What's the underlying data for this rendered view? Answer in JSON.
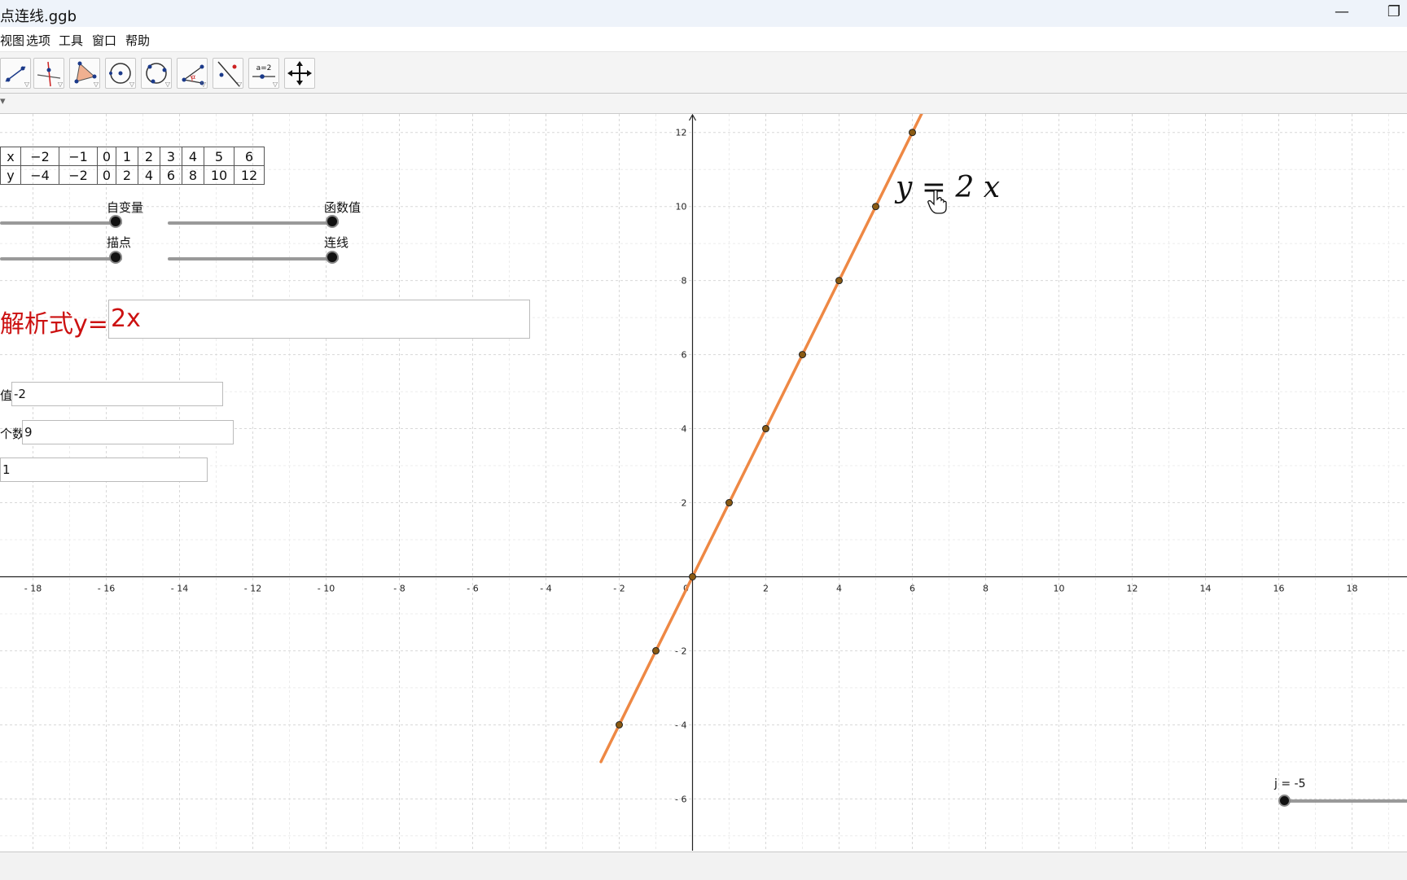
{
  "window": {
    "title": "点连线.ggb",
    "minimize_glyph": "—",
    "restore_glyph": "❐"
  },
  "menu": {
    "items": [
      "视图",
      "选项",
      "工具",
      "窗口",
      "帮助"
    ]
  },
  "toolbar": {
    "tools": [
      "segment-tool",
      "perpendicular-line-tool",
      "polygon-tool",
      "circle-center-point-tool",
      "circle-three-points-tool",
      "angle-tool",
      "reflect-tool",
      "slider-tool",
      "move-graphics-view-tool"
    ],
    "slider_tool_label": "a=2"
  },
  "stylebar": {
    "toggle": "▾"
  },
  "table": {
    "x_header": "x",
    "y_header": "y",
    "x_values": [
      "−2",
      "−1",
      "0",
      "1",
      "2",
      "3",
      "4",
      "5",
      "6"
    ],
    "y_values": [
      "−4",
      "−2",
      "0",
      "2",
      "4",
      "6",
      "8",
      "10",
      "12"
    ]
  },
  "sliders": {
    "independent_label": "自变量",
    "function_value_label": "函数值",
    "plot_points_label": "描点",
    "connect_label": "连线",
    "j_label": "j = -5",
    "independent_value": 1,
    "function_value_value": 1,
    "plot_points_value": 1,
    "connect_value": 1
  },
  "expression": {
    "label": "解析式y=",
    "value": "2x"
  },
  "fields": {
    "start_label": "值",
    "start_value": "-2",
    "count_label": "个数",
    "count_value": "9",
    "step_value": "1"
  },
  "equation_label": "y = 2 x",
  "chart_data": {
    "type": "line",
    "function": "y = 2x",
    "xlim": [
      -18.9,
      19.5
    ],
    "ylim": [
      -7.4,
      12.5
    ],
    "x_ticks": [
      -18,
      -16,
      -14,
      -12,
      -10,
      -8,
      -6,
      -4,
      -2,
      0,
      2,
      4,
      6,
      8,
      10,
      12,
      14,
      16,
      18
    ],
    "y_ticks": [
      -6,
      -4,
      -2,
      2,
      4,
      6,
      8,
      10,
      12
    ],
    "grid": true,
    "line_x_range": [
      -2.5,
      6.3
    ],
    "points": [
      {
        "x": -2,
        "y": -4
      },
      {
        "x": -1,
        "y": -2
      },
      {
        "x": 0,
        "y": 0
      },
      {
        "x": 1,
        "y": 2
      },
      {
        "x": 2,
        "y": 4
      },
      {
        "x": 3,
        "y": 6
      },
      {
        "x": 4,
        "y": 8
      },
      {
        "x": 5,
        "y": 10
      },
      {
        "x": 6,
        "y": 12
      }
    ],
    "line_color": "#ee8844",
    "point_color": "#8a5a12"
  }
}
